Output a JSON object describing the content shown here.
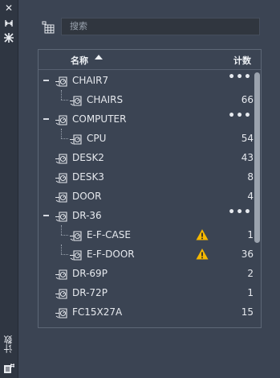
{
  "panel": {
    "title": "计数",
    "search_placeholder": "搜索",
    "columns": {
      "name": "名称",
      "count": "计数"
    },
    "rows": [
      {
        "label": "CHAIR7",
        "count": "",
        "expanded": true,
        "level": 0,
        "more": true,
        "warning": false
      },
      {
        "label": "CHAIRS",
        "count": "66",
        "level": 1,
        "warning": false
      },
      {
        "label": "COMPUTER",
        "count": "",
        "expanded": true,
        "level": 0,
        "more": true,
        "warning": false
      },
      {
        "label": "CPU",
        "count": "54",
        "level": 1,
        "warning": false
      },
      {
        "label": "DESK2",
        "count": "43",
        "level": 0,
        "warning": false
      },
      {
        "label": "DESK3",
        "count": "8",
        "level": 0,
        "warning": false
      },
      {
        "label": "DOOR",
        "count": "4",
        "level": 0,
        "warning": false
      },
      {
        "label": "DR-36",
        "count": "",
        "expanded": true,
        "level": 0,
        "more": true,
        "warning": false
      },
      {
        "label": "E-F-CASE",
        "count": "1",
        "level": 1,
        "warning": true
      },
      {
        "label": "E-F-DOOR",
        "count": "36",
        "level": 1,
        "warning": true
      },
      {
        "label": "DR-69P",
        "count": "2",
        "level": 0,
        "warning": false
      },
      {
        "label": "DR-72P",
        "count": "1",
        "level": 0,
        "warning": false
      },
      {
        "label": "FC15X27A",
        "count": "15",
        "level": 0,
        "warning": false
      }
    ],
    "more_label": "•••"
  },
  "colors": {
    "background": "#3b4453",
    "warning": "#f5b800",
    "scrollbar": "#9ba3ae"
  }
}
